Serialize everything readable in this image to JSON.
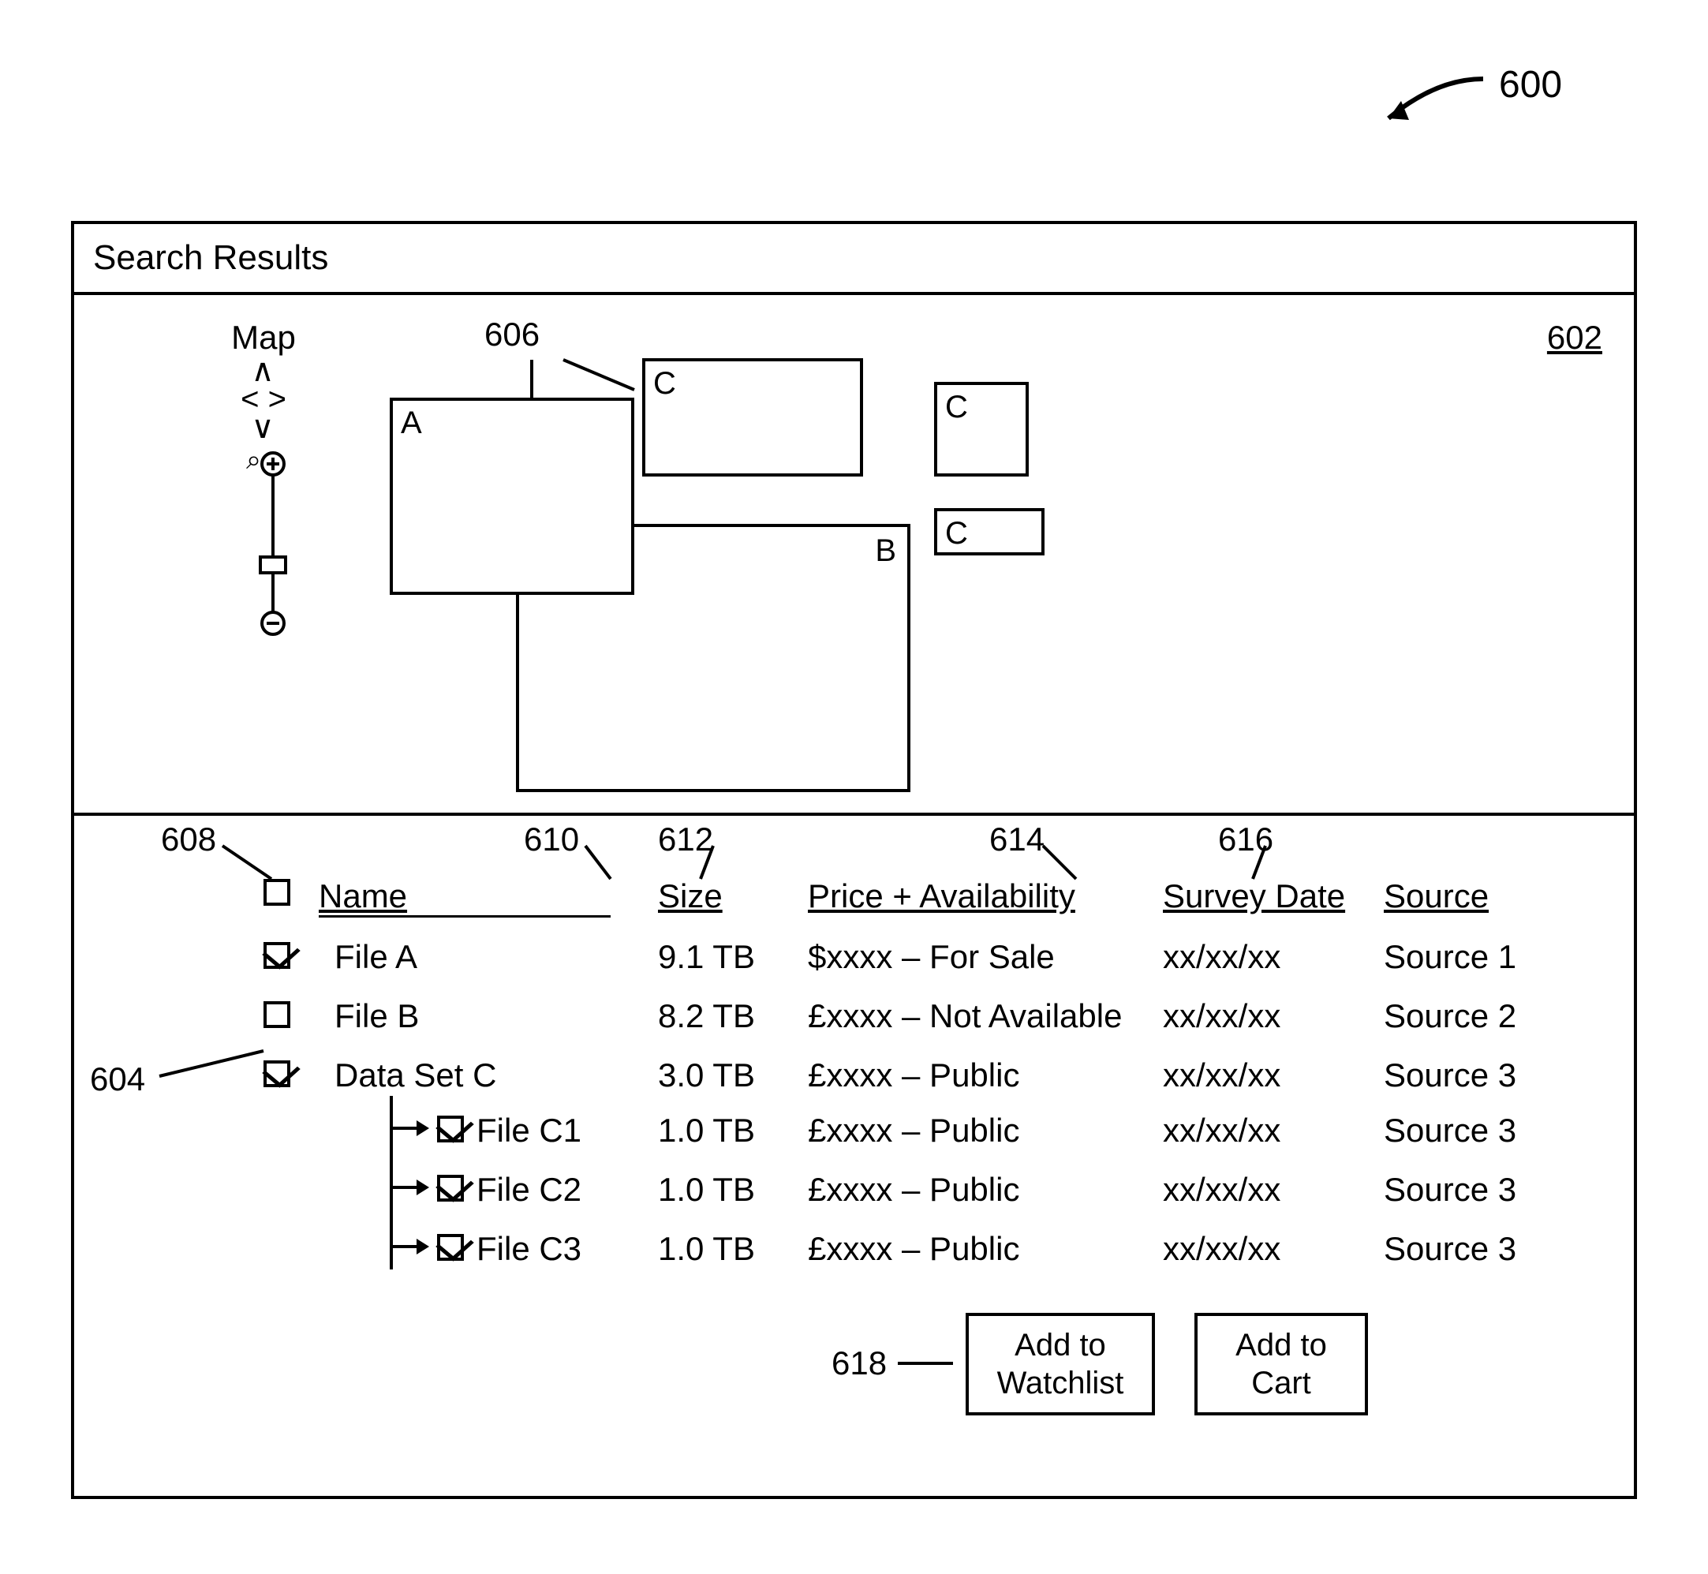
{
  "figure_number": "600",
  "title": "Search Results",
  "map_panel": {
    "ref": "602",
    "label": "Map",
    "regions_callout": "606",
    "regions": {
      "A": "A",
      "B": "B",
      "C_large": "C",
      "C_sq": "C",
      "C_wide": "C"
    }
  },
  "table": {
    "panel_callout": "604",
    "header_checkbox_callout": "608",
    "columns": {
      "name": {
        "label": "Name",
        "callout": "610"
      },
      "size": {
        "label": "Size",
        "callout": "612"
      },
      "price": {
        "label": "Price + Availability",
        "callout": "614"
      },
      "date": {
        "label": "Survey Date",
        "callout": "616"
      },
      "source": {
        "label": "Source"
      }
    },
    "rows": [
      {
        "checked": true,
        "name": "File A",
        "size": "9.1 TB",
        "price": "$xxxx – For Sale",
        "date": "xx/xx/xx",
        "source": "Source 1"
      },
      {
        "checked": false,
        "name": "File B",
        "size": "8.2 TB",
        "price": "£xxxx – Not Available",
        "date": "xx/xx/xx",
        "source": "Source 2"
      },
      {
        "checked": true,
        "name": "Data Set C",
        "size": "3.0 TB",
        "price": "£xxxx – Public",
        "date": "xx/xx/xx",
        "source": "Source 3"
      }
    ],
    "children": [
      {
        "checked": true,
        "name": "File C1",
        "size": "1.0 TB",
        "price": "£xxxx – Public",
        "date": "xx/xx/xx",
        "source": "Source 3"
      },
      {
        "checked": true,
        "name": "File C2",
        "size": "1.0 TB",
        "price": "£xxxx – Public",
        "date": "xx/xx/xx",
        "source": "Source 3"
      },
      {
        "checked": true,
        "name": "File C3",
        "size": "1.0 TB",
        "price": "£xxxx – Public",
        "date": "xx/xx/xx",
        "source": "Source 3"
      }
    ]
  },
  "buttons": {
    "callout": "618",
    "watchlist": "Add to\nWatchlist",
    "cart": "Add to\nCart"
  }
}
